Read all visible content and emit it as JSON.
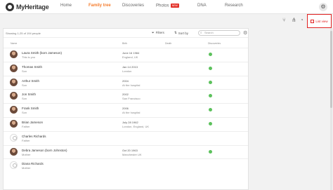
{
  "brand": {
    "name": "MyHeritage"
  },
  "nav": {
    "home": "Home",
    "family_tree": "Family tree",
    "discoveries": "Discoveries",
    "photos": "Photos",
    "photos_badge": "NEW",
    "dna": "DNA",
    "research": "Research"
  },
  "toolbar": {
    "list_view": "List view"
  },
  "list": {
    "count_text": "Showing 1-25 of 194 people",
    "filters_label": "Filters",
    "sort_label": "Sort by",
    "search_placeholder": "Search",
    "columns": {
      "name": "Name",
      "birth": "Birth",
      "death": "Death",
      "discoveries": "Discoveries"
    }
  },
  "people": [
    {
      "name": "Laura Smith (born Jameson)",
      "relation": "This is you",
      "birth_date": "June 16 1984",
      "birth_place": "England, UK",
      "discovery": true,
      "photo": true
    },
    {
      "name": "Thomas Smith",
      "relation": "Son",
      "birth_date": "Jan 14 2013",
      "birth_place": "London",
      "discovery": true,
      "photo": true
    },
    {
      "name": "Arthur Smith",
      "relation": "Son",
      "birth_date": "2004",
      "birth_place": "At the hospital",
      "discovery": true,
      "photo": true
    },
    {
      "name": "Jon Smith",
      "relation": "Son",
      "birth_date": "2002",
      "birth_place": "San Francisco",
      "discovery": true,
      "photo": true
    },
    {
      "name": "Frank Smith",
      "relation": "Son",
      "birth_date": "2006",
      "birth_place": "At the hospital",
      "discovery": true,
      "photo": true
    },
    {
      "name": "Brian Jameson",
      "relation": "Father",
      "birth_date": "July 28 1962",
      "birth_place": "London, England, UK",
      "discovery": true,
      "photo": true
    },
    {
      "name": "Charles Richards",
      "relation": "Father",
      "birth_date": "",
      "birth_place": "",
      "discovery": false,
      "photo": false
    },
    {
      "name": "Debra Jameson (born Johnston)",
      "relation": "Mother",
      "birth_date": "Oct 20 1963",
      "birth_place": "Manchester UK",
      "discovery": true,
      "photo": true
    },
    {
      "name": "Diana Richards",
      "relation": "Mother",
      "birth_date": "",
      "birth_place": "",
      "discovery": false,
      "photo": false
    }
  ]
}
